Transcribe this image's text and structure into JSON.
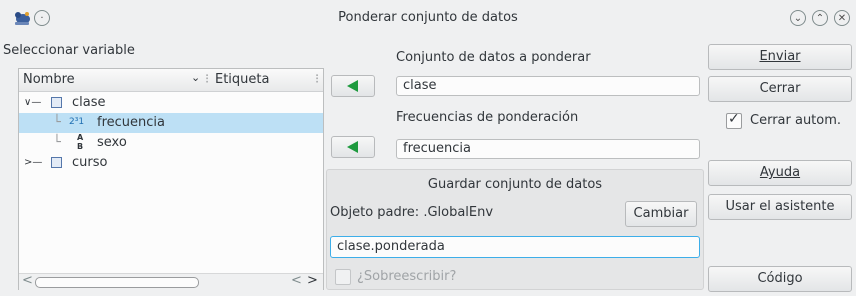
{
  "window": {
    "title": "Ponderar conjunto de datos",
    "controls": [
      "minimize-icon",
      "maximize-icon",
      "close-icon"
    ]
  },
  "variables": {
    "heading": "Seleccionar variable",
    "columns": {
      "name": "Nombre",
      "label": "Etiqueta"
    },
    "tree": [
      {
        "name": "clase",
        "expanded": true,
        "children": [
          {
            "name": "frecuencia",
            "type": "numeric",
            "type_glyph": "2³1",
            "selected": true
          },
          {
            "name": "sexo",
            "type": "factor",
            "type_glyph": "A|B"
          }
        ]
      },
      {
        "name": "curso",
        "expanded": false,
        "children": []
      }
    ]
  },
  "dataset": {
    "label": "Conjunto de datos a ponderar",
    "value": "clase"
  },
  "weights": {
    "label": "Frecuencias de ponderación",
    "value": "frecuencia"
  },
  "save": {
    "title": "Guardar conjunto de datos",
    "parent_label": "Objeto padre: .GlobalEnv",
    "change_button": "Cambiar",
    "name_value": "clase.ponderada",
    "overwrite_label": "¿Sobreescribir?",
    "overwrite_checked": false
  },
  "actions": {
    "submit": "Enviar",
    "close": "Cerrar",
    "auto_close": "Cerrar autom.",
    "auto_close_checked": true,
    "help": "Ayuda",
    "wizard": "Usar el asistente",
    "code": "Código"
  },
  "colors": {
    "accent": "#3daee9",
    "arrow": "#1e9a3e",
    "selection": "#bde0f5"
  }
}
